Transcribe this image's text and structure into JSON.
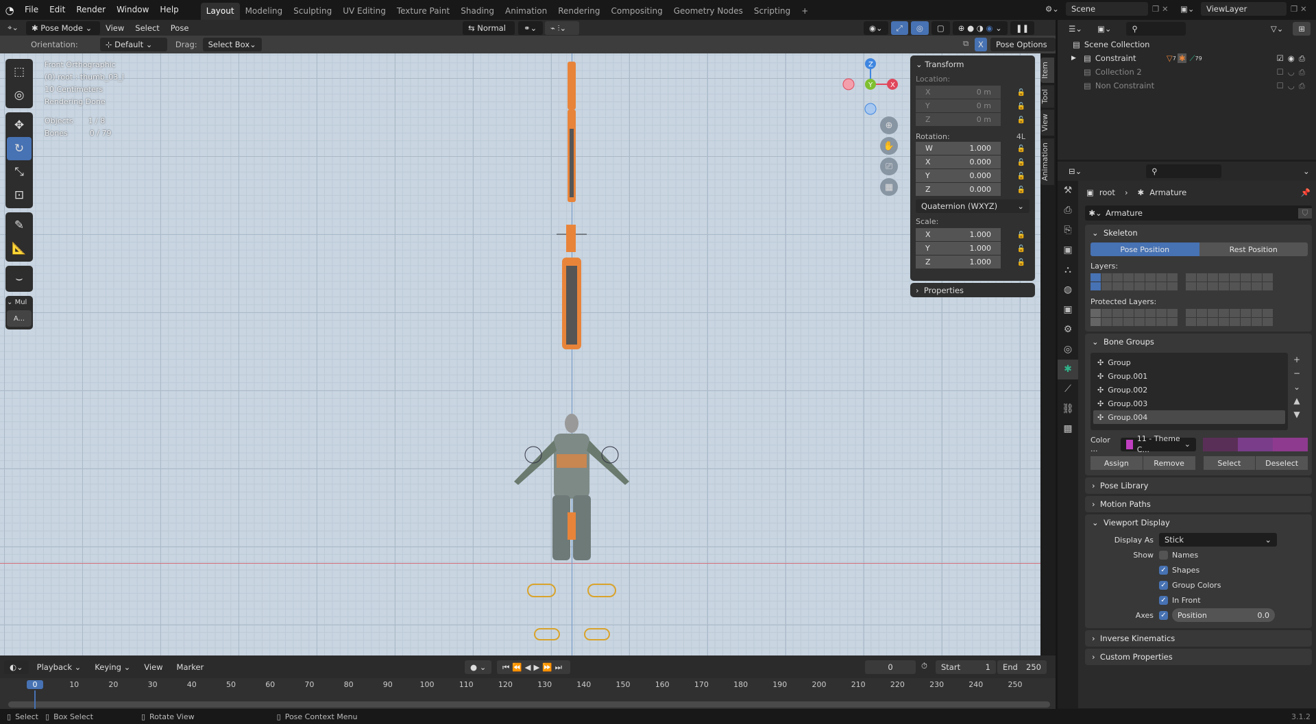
{
  "menus": [
    "File",
    "Edit",
    "Render",
    "Window",
    "Help"
  ],
  "workspaces": [
    "Layout",
    "Modeling",
    "Sculpting",
    "UV Editing",
    "Texture Paint",
    "Shading",
    "Animation",
    "Rendering",
    "Compositing",
    "Geometry Nodes",
    "Scripting",
    "+"
  ],
  "active_workspace": "Layout",
  "scene": {
    "name": "Scene",
    "view_layer": "ViewLayer"
  },
  "header": {
    "mode": "Pose Mode",
    "menus": [
      "View",
      "Select",
      "Pose"
    ],
    "transform_orientation": "Normal"
  },
  "tool_settings": {
    "orientation_label": "Orientation:",
    "orientation": "Default",
    "drag_label": "Drag:",
    "drag": "Select Box",
    "x_mirror": "X",
    "pose_options": "Pose Options"
  },
  "viewport_info": {
    "view": "Front Orthographic",
    "active": "(0) root : thumb_03_l",
    "scale": "10 Centimeters",
    "status": "Rendering Done",
    "objects_label": "Objects",
    "objects": "1 / 8",
    "bones_label": "Bones",
    "bones": "0 / 79"
  },
  "gizmo": {
    "x": "X",
    "y": "Y",
    "z": "Z"
  },
  "toolbar_extra": {
    "section": "Mul",
    "button": "A..."
  },
  "npanel": {
    "tabs": [
      "Item",
      "Tool",
      "View",
      "Animation"
    ],
    "transform_title": "Transform",
    "location_label": "Location:",
    "location": [
      {
        "axis": "X",
        "value": "0 m"
      },
      {
        "axis": "Y",
        "value": "0 m"
      },
      {
        "axis": "Z",
        "value": "0 m"
      }
    ],
    "rotation_label": "Rotation:",
    "rotation_mode_short": "4L",
    "rotation": [
      {
        "axis": "W",
        "value": "1.000"
      },
      {
        "axis": "X",
        "value": "0.000"
      },
      {
        "axis": "Y",
        "value": "0.000"
      },
      {
        "axis": "Z",
        "value": "0.000"
      }
    ],
    "rotation_mode": "Quaternion (WXYZ)",
    "scale_label": "Scale:",
    "scale": [
      {
        "axis": "X",
        "value": "1.000"
      },
      {
        "axis": "Y",
        "value": "1.000"
      },
      {
        "axis": "Z",
        "value": "1.000"
      }
    ],
    "properties_title": "Properties"
  },
  "outliner": {
    "root": "Scene Collection",
    "items": [
      {
        "name": "Constraint",
        "badge1": "7",
        "badge2": "79",
        "enabled": true
      },
      {
        "name": "Collection 2",
        "enabled": false
      },
      {
        "name": "Non Constraint",
        "enabled": false
      }
    ]
  },
  "properties": {
    "breadcrumb": [
      "root",
      "Armature"
    ],
    "data_name": "Armature",
    "skeleton": {
      "title": "Skeleton",
      "pose_position": "Pose Position",
      "rest_position": "Rest Position",
      "active": "Pose Position",
      "layers_label": "Layers:",
      "protected_label": "Protected Layers:"
    },
    "bone_groups": {
      "title": "Bone Groups",
      "items": [
        "Group",
        "Group.001",
        "Group.002",
        "Group.003",
        "Group.004"
      ],
      "selected": "Group.004",
      "color_label": "Color ...",
      "color_set": "11 - Theme C...",
      "swatches": [
        "#5a2f57",
        "#7a3d8a",
        "#8e3a8e"
      ],
      "assign": "Assign",
      "remove": "Remove",
      "select": "Select",
      "deselect": "Deselect"
    },
    "collapsed": [
      "Pose Library",
      "Motion Paths"
    ],
    "viewport_display": {
      "title": "Viewport Display",
      "display_as_label": "Display As",
      "display_as": "Stick",
      "show_label": "Show",
      "options": [
        {
          "label": "Names",
          "checked": false
        },
        {
          "label": "Shapes",
          "checked": true
        },
        {
          "label": "Group Colors",
          "checked": true
        },
        {
          "label": "In Front",
          "checked": true
        }
      ],
      "axes_label": "Axes",
      "axes_checked": true,
      "axes_position_label": "Position",
      "axes_position": "0.0"
    },
    "collapsed2": [
      "Inverse Kinematics",
      "Custom Properties"
    ]
  },
  "timeline": {
    "menus": [
      "Playback",
      "Keying",
      "View",
      "Marker"
    ],
    "current_frame": "0",
    "start_label": "Start",
    "start": "1",
    "end_label": "End",
    "end": "250",
    "ticks": [
      "0",
      "10",
      "20",
      "30",
      "40",
      "50",
      "60",
      "70",
      "80",
      "90",
      "100",
      "110",
      "120",
      "130",
      "140",
      "150",
      "160",
      "170",
      "180",
      "190",
      "200",
      "210",
      "220",
      "230",
      "240",
      "250"
    ]
  },
  "statusbar": {
    "items": [
      "Select",
      "Box Select",
      "Rotate View",
      "Pose Context Menu"
    ],
    "version": "3.1.2"
  },
  "colors": {
    "accent": "#4772b3",
    "x_axis": "#e0475b",
    "y_axis": "#7fbf30",
    "z_axis": "#3f86e0",
    "bone_orange": "#e8843a"
  }
}
